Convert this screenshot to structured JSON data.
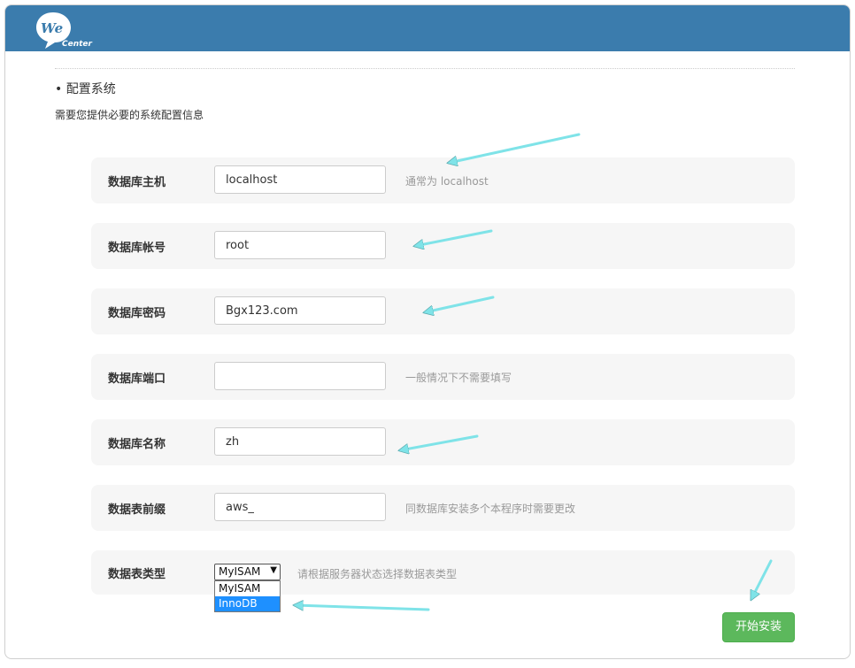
{
  "header": {
    "logo_we": "We",
    "logo_center": "Center"
  },
  "section": {
    "title": "• 配置系统",
    "description": "需要您提供必要的系统配置信息"
  },
  "form": {
    "db_host": {
      "label": "数据库主机",
      "value": "localhost",
      "hint": "通常为 localhost"
    },
    "db_user": {
      "label": "数据库帐号",
      "value": "root",
      "hint": ""
    },
    "db_pass": {
      "label": "数据库密码",
      "value": "Bgx123.com",
      "hint": ""
    },
    "db_port": {
      "label": "数据库端口",
      "value": "",
      "hint": "一般情况下不需要填写"
    },
    "db_name": {
      "label": "数据库名称",
      "value": "zh",
      "hint": ""
    },
    "db_prefix": {
      "label": "数据表前缀",
      "value": "aws_",
      "hint": "同数据库安装多个本程序时需要更改"
    },
    "db_engine": {
      "label": "数据表类型",
      "selected": "MyISAM",
      "hint": "请根据服务器状态选择数据表类型",
      "options": [
        "MyISAM",
        "InnoDB"
      ],
      "highlighted": "InnoDB"
    }
  },
  "actions": {
    "install_label": "开始安装"
  },
  "colors": {
    "header": "#3b7cad",
    "row_bg": "#f6f6f6",
    "button": "#5cb85c",
    "annotation_arrow": "#7fe3e8",
    "dropdown_highlight": "#1e90ff"
  },
  "icons": {
    "select_arrow": "triangle-down-icon",
    "logo": "speech-bubble-logo-icon"
  }
}
